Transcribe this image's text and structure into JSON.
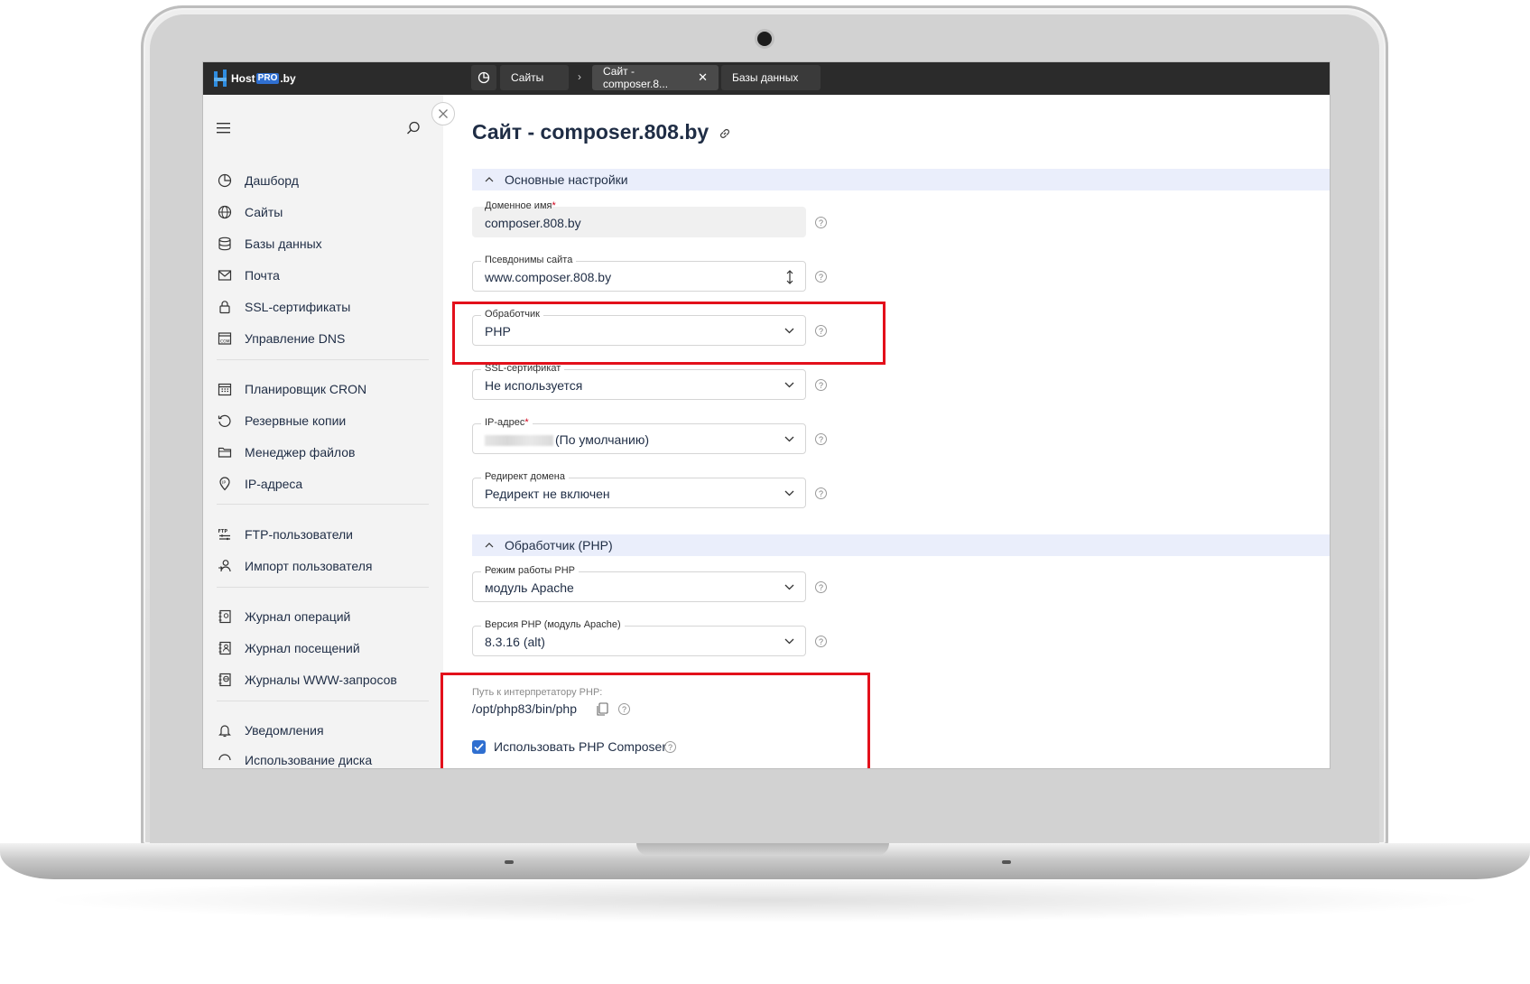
{
  "brand": {
    "prefix": "Host",
    "pro": "PRO",
    "suffix": ".by"
  },
  "tabs": [
    {
      "label": "Сайты"
    },
    {
      "label": "Сайт - composer.8..."
    },
    {
      "label": "Базы данных"
    }
  ],
  "sidebar": {
    "items": [
      {
        "label": "Дашборд",
        "icon": "dashboard-icon"
      },
      {
        "label": "Сайты",
        "icon": "globe-icon"
      },
      {
        "label": "Базы данных",
        "icon": "database-icon"
      },
      {
        "label": "Почта",
        "icon": "mail-icon"
      },
      {
        "label": "SSL-сертификаты",
        "icon": "lock-icon"
      },
      {
        "label": "Управление DNS",
        "icon": "dns-icon"
      },
      {
        "label": "Планировщик CRON",
        "icon": "calendar-icon"
      },
      {
        "label": "Резервные копии",
        "icon": "backup-icon"
      },
      {
        "label": "Менеджер файлов",
        "icon": "folder-icon"
      },
      {
        "label": "IP-адреса",
        "icon": "ip-icon"
      },
      {
        "label": "FTP-пользователи",
        "icon": "ftp-icon"
      },
      {
        "label": "Импорт пользователя",
        "icon": "user-import-icon"
      },
      {
        "label": "Журнал операций",
        "icon": "operations-log-icon"
      },
      {
        "label": "Журнал посещений",
        "icon": "visits-log-icon"
      },
      {
        "label": "Журналы WWW-запросов",
        "icon": "www-log-icon"
      },
      {
        "label": "Уведомления",
        "icon": "bell-icon"
      },
      {
        "label": "Использование диска",
        "icon": "disk-icon"
      }
    ]
  },
  "page": {
    "title": "Сайт - composer.808.by",
    "sections": {
      "basic": "Основные настройки",
      "handler": "Обработчик (PHP)"
    },
    "fields": {
      "domain": {
        "label": "Доменное имя",
        "value": "composer.808.by"
      },
      "aliases": {
        "label": "Псевдонимы сайта",
        "value": "www.composer.808.by"
      },
      "handler": {
        "label": "Обработчик",
        "value": "PHP"
      },
      "ssl": {
        "label": "SSL-сертификат",
        "value": "Не используется"
      },
      "ip": {
        "label": "IP-адрес",
        "value": "(По умолчанию)"
      },
      "redirect": {
        "label": "Редирект домена",
        "value": "Редирект не включен"
      },
      "php_mode": {
        "label": "Режим работы PHP",
        "value": "модуль Apache"
      },
      "php_version": {
        "label": "Версия PHP (модуль Apache)",
        "value": "8.3.16 (alt)"
      }
    },
    "interpreter": {
      "label": "Путь к интерпретатору PHP:",
      "value": "/opt/php83/bin/php"
    },
    "composer": {
      "label": "Использовать PHP Composer",
      "checked": true
    },
    "help_glyph": "?",
    "required_mark": "*"
  },
  "colors": {
    "topbar": "#2b2b2b",
    "sidebar": "#f3f3f3",
    "section": "#eaeefb",
    "highlight": "#e3101b",
    "accent": "#2f6fd0"
  }
}
